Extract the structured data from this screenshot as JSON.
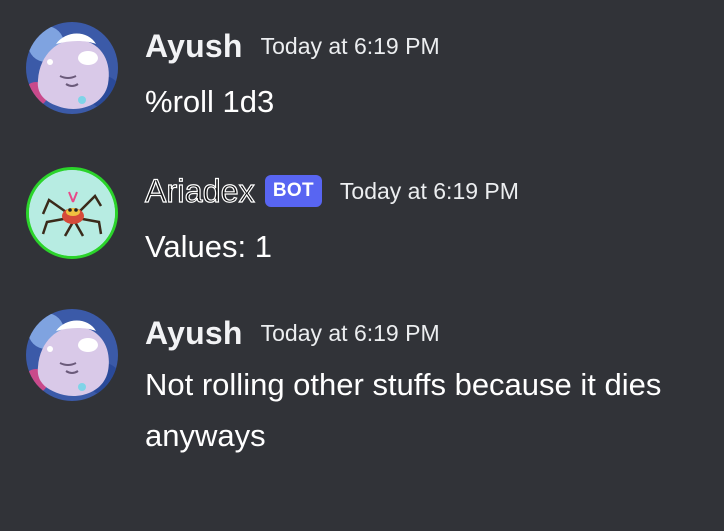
{
  "messages": [
    {
      "username": "Ayush",
      "timestamp": "Today at 6:19 PM",
      "content": "%roll 1d3",
      "avatar_icon": "blob-creature-avatar-icon"
    },
    {
      "username": "Ariadex",
      "bot_tag": "BOT",
      "timestamp": "Today at 6:19 PM",
      "content": "Values: 1",
      "avatar_icon": "spider-avatar-icon",
      "avatar_border_color": "#2bd42b"
    },
    {
      "username": "Ayush",
      "timestamp": "Today at 6:19 PM",
      "content": "Not rolling other stuffs because it dies anyways",
      "avatar_icon": "blob-creature-avatar-icon"
    }
  ],
  "colors": {
    "background": "#313338",
    "bot_tag": "#5865f2"
  }
}
